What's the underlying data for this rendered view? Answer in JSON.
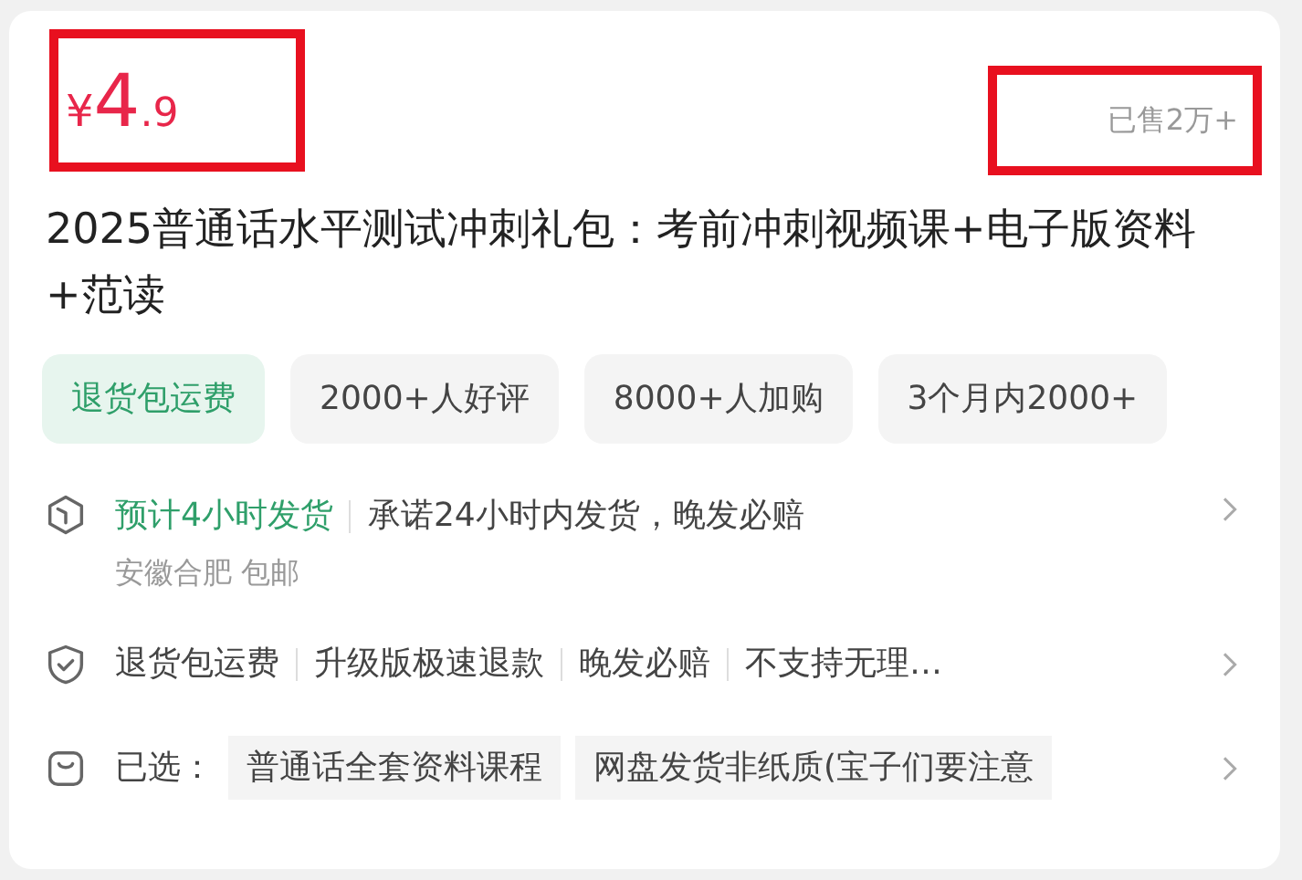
{
  "price": {
    "currency": "¥",
    "integer": "4",
    "decimal": ".9",
    "highlighted": true
  },
  "sold": {
    "text": "已售2万+",
    "highlighted": true
  },
  "title": "2025普通话水平测试冲刺礼包：考前冲刺视频课+电子版资料+范读",
  "tags": [
    {
      "label": "退货包运费",
      "highlighted": true
    },
    {
      "label": "2000+人好评",
      "highlighted": false
    },
    {
      "label": "8000+人加购",
      "highlighted": false
    },
    {
      "label": "3个月内2000+",
      "highlighted": false
    }
  ],
  "shipping": {
    "highlight": "预计4小时发货",
    "promise": "承诺24小时内发货，晚发必赔",
    "origin": "安徽合肥 包邮"
  },
  "services": [
    "退货包运费",
    "升级版极速退款",
    "晚发必赔",
    "不支持无理…"
  ],
  "selection": {
    "label": "已选：",
    "options": [
      "普通话全套资料课程",
      "网盘发货非纸质(宝子们要注意"
    ]
  }
}
